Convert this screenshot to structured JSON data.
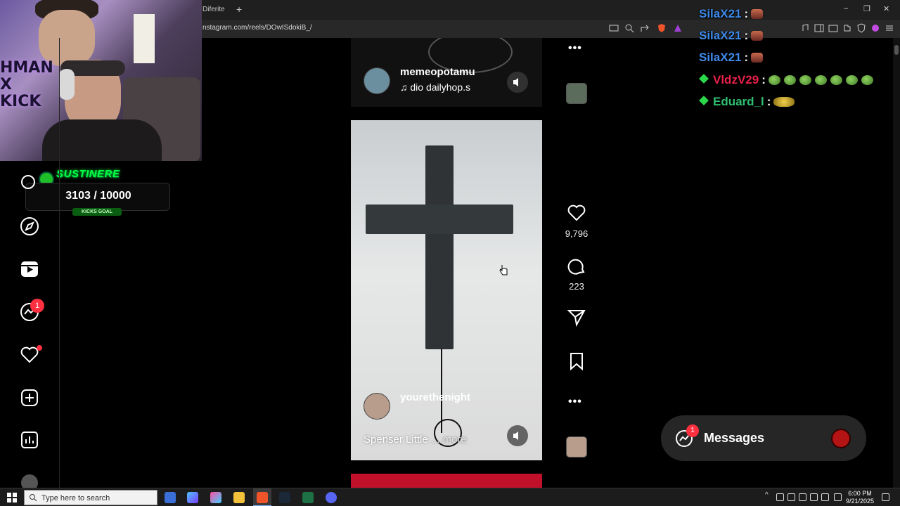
{
  "browser": {
    "tab_fragment": "Diferite",
    "new_tab": "+",
    "url": "nstagram.com/reels/DOwISdokiB_/",
    "window_controls": [
      "–",
      "❐",
      "✕"
    ]
  },
  "stream": {
    "webcam_text": "HMAN\nX\nKICK",
    "goal_title": "SUSTINERE",
    "goal_count": "3103  / 10000",
    "goal_label": "KICKS GOAL"
  },
  "chat": [
    {
      "user": "SilaX21",
      "color": "#3f8bea",
      "emotes": [
        "red"
      ]
    },
    {
      "user": "SilaX21",
      "color": "#3f8bea",
      "emotes": [
        "red"
      ]
    },
    {
      "user": "SilaX21",
      "color": "#3f8bea",
      "emotes": [
        "red"
      ]
    },
    {
      "user": "VldzV29",
      "color": "#e8214a",
      "badge": true,
      "emotes": [
        "green",
        "green",
        "green",
        "green",
        "green",
        "green",
        "green"
      ]
    },
    {
      "user": "Eduard_l",
      "color": "#2fbf71",
      "badge": true,
      "emotes": [
        "face"
      ]
    }
  ],
  "nav": {
    "icons": [
      "search-icon",
      "explore-icon",
      "reels-icon",
      "messenger-icon",
      "notifications-icon",
      "create-icon",
      "dashboard-icon",
      "profile-icon"
    ],
    "messenger_badge": "1"
  },
  "reels": {
    "top": {
      "username": "memeopotamu",
      "music": "dio  dailyhop.s"
    },
    "main": {
      "username": "yourethenight",
      "description": "Spenser Little",
      "more": " ... more"
    }
  },
  "actions": {
    "likes": "9,796",
    "comments": "223",
    "more": "•••"
  },
  "messages": {
    "label": "Messages",
    "badge": "1"
  },
  "taskbar": {
    "search_placeholder": "Type here to search",
    "time": "6:00 PM",
    "date": "9/21/2025"
  }
}
